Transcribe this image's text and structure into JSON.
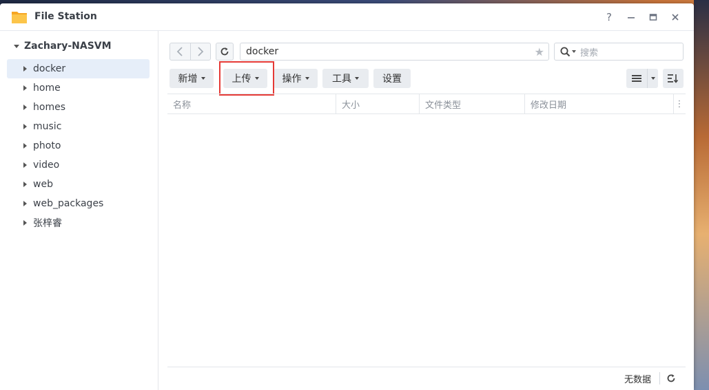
{
  "window": {
    "title": "File Station",
    "controls": {
      "help": "?"
    }
  },
  "sidebar": {
    "root": "Zachary-NASVM",
    "items": [
      {
        "label": "docker",
        "selected": true
      },
      {
        "label": "home"
      },
      {
        "label": "homes"
      },
      {
        "label": "music"
      },
      {
        "label": "photo"
      },
      {
        "label": "video"
      },
      {
        "label": "web"
      },
      {
        "label": "web_packages"
      },
      {
        "label": "张梓睿"
      }
    ]
  },
  "toolbar": {
    "path": "docker",
    "search_placeholder": "搜索",
    "buttons": {
      "create": "新增",
      "upload": "上传",
      "action": "操作",
      "tools": "工具",
      "settings": "设置"
    }
  },
  "grid": {
    "columns": [
      "名称",
      "大小",
      "文件类型",
      "修改日期"
    ]
  },
  "status": {
    "text": "无数据"
  },
  "colors": {
    "accent": "#0086e5",
    "selected_bg": "#e6eef9",
    "highlight_border": "#e53935"
  }
}
